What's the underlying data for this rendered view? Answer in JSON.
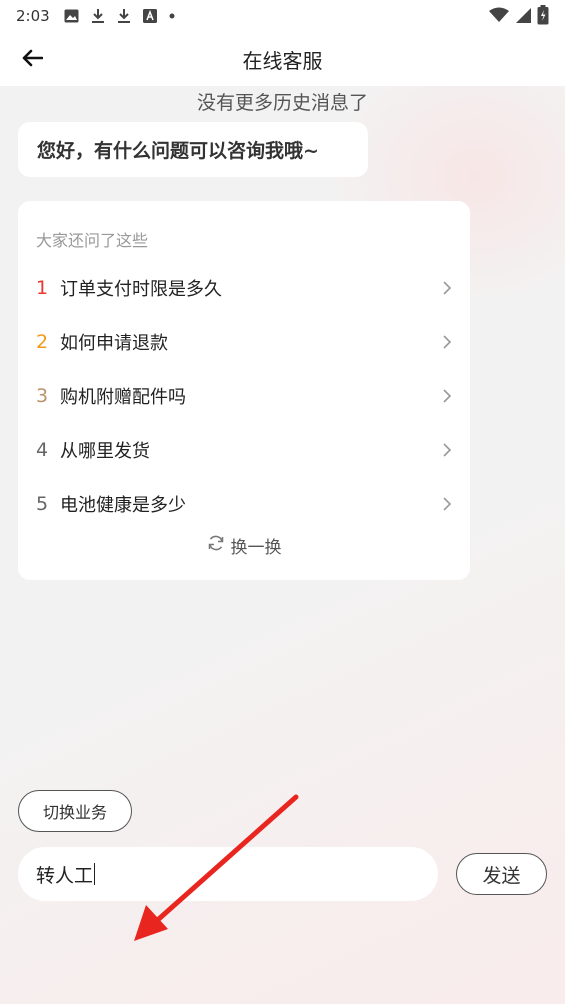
{
  "status_bar": {
    "time": "2:03",
    "left_icons": [
      "image-icon",
      "download-icon",
      "download-icon",
      "font-icon",
      "dot-icon"
    ],
    "right_icons": [
      "wifi-icon",
      "signal-icon",
      "battery-icon"
    ]
  },
  "header": {
    "title": "在线客服",
    "back_icon": "arrow-left-icon"
  },
  "chat": {
    "history_note": "没有更多历史消息了",
    "greeting": "您好，有什么问题可以咨询我哦~",
    "faq": {
      "heading": "大家还问了这些",
      "items": [
        {
          "num": "1",
          "text": "订单支付时限是多久",
          "color": "#e8392f"
        },
        {
          "num": "2",
          "text": "如何申请退款",
          "color": "#f29a1b"
        },
        {
          "num": "3",
          "text": "购机附赠配件吗",
          "color": "#b9936b"
        },
        {
          "num": "4",
          "text": "从哪里发货",
          "color": "#666666"
        },
        {
          "num": "5",
          "text": "电池健康是多少",
          "color": "#666666"
        }
      ],
      "refresh_label": "换一换"
    }
  },
  "footer": {
    "switch_label": "切换业务",
    "input_value": "转人工",
    "send_label": "发送"
  },
  "colors": {
    "annotation_arrow": "#e8261f"
  }
}
